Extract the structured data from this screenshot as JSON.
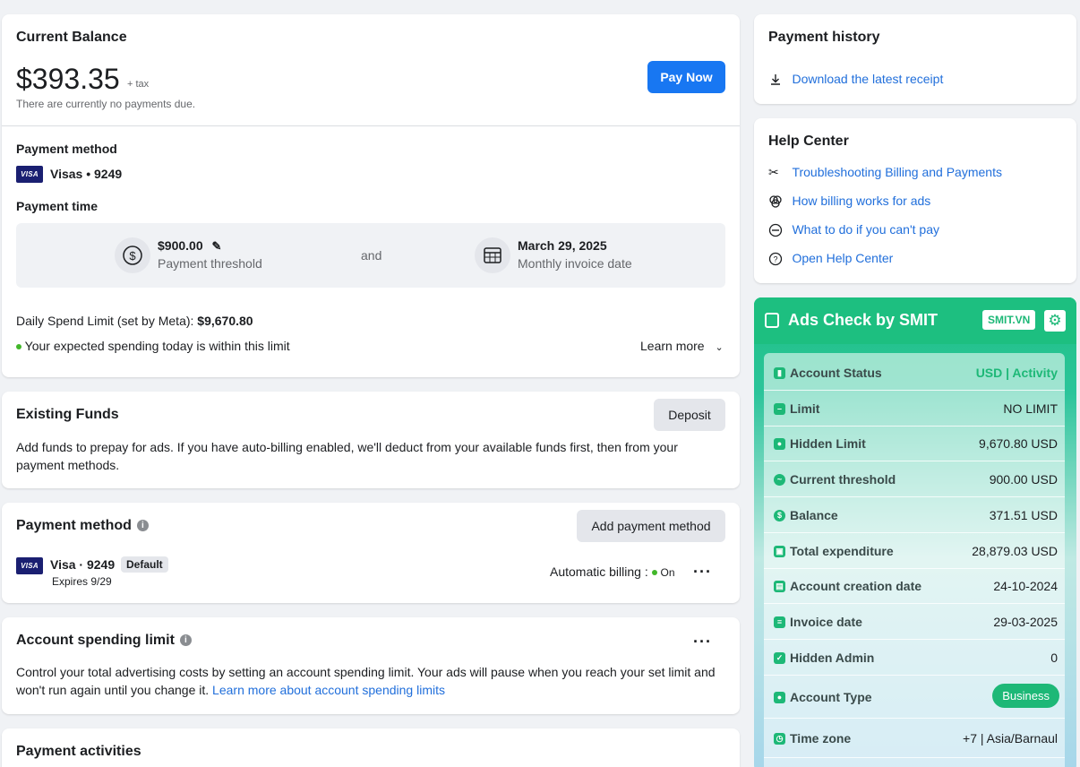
{
  "current_balance": {
    "title": "Current Balance",
    "amount": "$393.35",
    "tax": "+ tax",
    "note": "There are currently no payments due.",
    "pay_button": "Pay Now",
    "payment_method_label": "Payment method",
    "card_brand": "VISA",
    "card_text": "Visas • 9249",
    "payment_time_label": "Payment time",
    "threshold_amount": "$900.00",
    "threshold_caption": "Payment threshold",
    "and": "and",
    "invoice_date": "March 29, 2025",
    "invoice_caption": "Monthly invoice date",
    "daily_limit_label": "Daily Spend Limit (set by Meta): ",
    "daily_limit_value": "$9,670.80",
    "within_limit": "Your expected spending today is within this limit",
    "learn_more": "Learn more"
  },
  "existing_funds": {
    "title": "Existing Funds",
    "deposit_button": "Deposit",
    "description": "Add funds to prepay for ads. If you have auto-billing enabled, we'll deduct from your available funds first, then from your payment methods."
  },
  "payment_method": {
    "title": "Payment method",
    "add_button": "Add payment method",
    "card_brand": "VISA",
    "card_text": "Visa · 9249",
    "default_badge": "Default",
    "expires": "Expires 9/29",
    "auto_billing_label": "Automatic billing :",
    "auto_billing_state": "On"
  },
  "spending_limit": {
    "title": "Account spending limit",
    "description": "Control your total advertising costs by setting an account spending limit. Your ads will pause when you reach your set limit and won't run again until you change it. ",
    "link": "Learn more about account spending limits"
  },
  "payment_activities": {
    "title": "Payment activities"
  },
  "payment_history": {
    "title": "Payment history",
    "download_link": "Download the latest receipt"
  },
  "help_center": {
    "title": "Help Center",
    "links": [
      "Troubleshooting Billing and Payments",
      "How billing works for ads",
      "What to do if you can't pay",
      "Open Help Center"
    ]
  },
  "smit": {
    "title": "Ads Check by SMIT",
    "badge": "SMIT.VN",
    "rows": [
      {
        "label": "Account Status",
        "value": "USD | Activity"
      },
      {
        "label": "Limit",
        "value": "NO LIMIT"
      },
      {
        "label": "Hidden Limit",
        "value": "9,670.80 USD"
      },
      {
        "label": "Current threshold",
        "value": "900.00 USD"
      },
      {
        "label": "Balance",
        "value": "371.51 USD"
      },
      {
        "label": "Total expenditure",
        "value": "28,879.03 USD"
      },
      {
        "label": "Account creation date",
        "value": "24-10-2024"
      },
      {
        "label": "Invoice date",
        "value": "29-03-2025"
      },
      {
        "label": "Hidden Admin",
        "value": "0"
      },
      {
        "label": "Account Type",
        "value": "Business"
      },
      {
        "label": "Time zone",
        "value": "+7 | Asia/Barnaul"
      }
    ],
    "accent": "#1dbf80"
  }
}
